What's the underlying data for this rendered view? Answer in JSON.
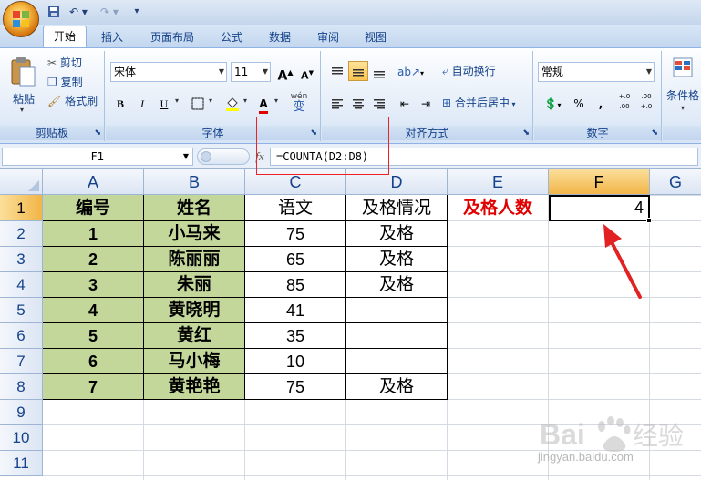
{
  "titlebar": {
    "qat_save_icon": "save-icon",
    "qat_undo_icon": "undo-icon",
    "qat_redo_icon": "redo-icon"
  },
  "tabs": [
    {
      "label": "开始",
      "active": true
    },
    {
      "label": "插入"
    },
    {
      "label": "页面布局"
    },
    {
      "label": "公式"
    },
    {
      "label": "数据"
    },
    {
      "label": "审阅"
    },
    {
      "label": "视图"
    }
  ],
  "ribbon": {
    "clipboard": {
      "paste": "粘贴",
      "cut": "剪切",
      "copy": "复制",
      "format_painter": "格式刷",
      "label": "剪贴板"
    },
    "font": {
      "name": "宋体",
      "size": "11",
      "grow": "A",
      "shrink": "A",
      "bold": "B",
      "italic": "I",
      "underline": "U",
      "font_color_glyph": "A",
      "wen": "wén",
      "phonetic": "变",
      "label": "字体"
    },
    "alignment": {
      "wrap": "自动换行",
      "merge": "合并后居中",
      "label": "对齐方式"
    },
    "number": {
      "format": "常规",
      "percent": "%",
      "comma": ",",
      "inc_decimals": "+.0 .00",
      "dec_decimals": ".00 +.0",
      "label": "数字"
    },
    "styles": {
      "conditional": "条件格"
    }
  },
  "formula_bar": {
    "name_box": "F1",
    "fx": "fx",
    "formula": "=COUNTA(D2:D8)"
  },
  "columns": [
    "A",
    "B",
    "C",
    "D",
    "E",
    "F",
    "G"
  ],
  "rows": [
    "1",
    "2",
    "3",
    "4",
    "5",
    "6",
    "7",
    "8",
    "9",
    "10",
    "11"
  ],
  "sheet": {
    "header": [
      "编号",
      "姓名",
      "语文",
      "及格情况"
    ],
    "data": [
      [
        "1",
        "小马来",
        "75",
        "及格"
      ],
      [
        "2",
        "陈丽丽",
        "65",
        "及格"
      ],
      [
        "3",
        "朱丽",
        "85",
        "及格"
      ],
      [
        "4",
        "黄晓明",
        "41",
        ""
      ],
      [
        "5",
        "黄红",
        "35",
        ""
      ],
      [
        "6",
        "马小梅",
        "10",
        ""
      ],
      [
        "7",
        "黄艳艳",
        "75",
        "及格"
      ]
    ],
    "e1": "及格人数",
    "f1": "4"
  },
  "colors": {
    "green_fill": "#c4d79b",
    "red_text": "#e00000",
    "annotation_red": "#e22222",
    "selected_header": "#f2b548"
  },
  "watermark": {
    "text": "jingyan.baidu.com"
  }
}
